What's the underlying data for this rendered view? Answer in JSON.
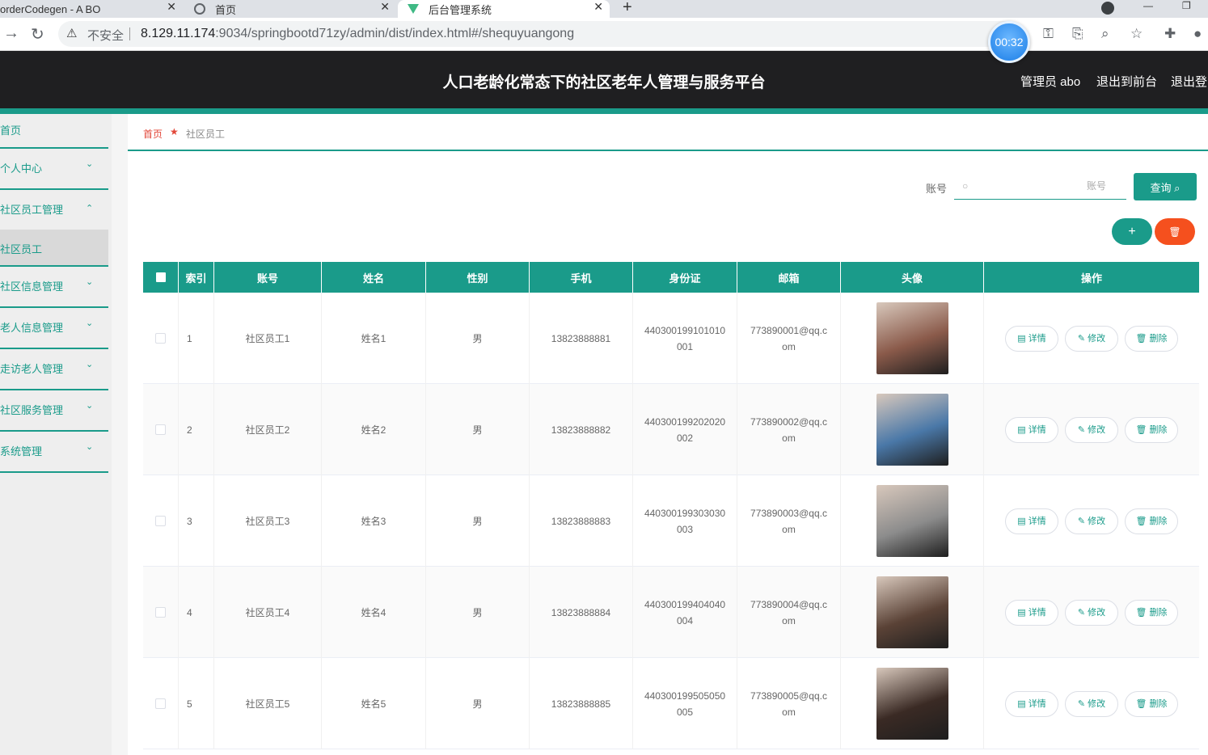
{
  "browser": {
    "tabs": [
      {
        "label": "orderCodegen - A BO"
      },
      {
        "label": "首页"
      },
      {
        "label": "后台管理系统"
      }
    ],
    "insecure_label": "不安全",
    "url_host": "8.129.11.174",
    "url_rest": ":9034/springbootd71zy/admin/dist/index.html#/shequyuangong",
    "timer": "00:32"
  },
  "header": {
    "title": "人口老龄化常态下的社区老年人管理与服务平台",
    "user": "管理员 abo",
    "to_front": "退出到前台",
    "logout": "退出登录"
  },
  "sidebar": {
    "items": [
      {
        "label": "首页",
        "chevron": ""
      },
      {
        "label": "个人中心",
        "chevron": "⌄"
      },
      {
        "label": "社区员工管理",
        "chevron": "⌃"
      },
      {
        "label": "社区员工",
        "chevron": ""
      },
      {
        "label": "社区信息管理",
        "chevron": "⌄"
      },
      {
        "label": "老人信息管理",
        "chevron": "⌄"
      },
      {
        "label": "走访老人管理",
        "chevron": "⌄"
      },
      {
        "label": "社区服务管理",
        "chevron": "⌄"
      },
      {
        "label": "系统管理",
        "chevron": "⌄"
      }
    ]
  },
  "breadcrumb": {
    "home": "首页",
    "current": "社区员工"
  },
  "search": {
    "label": "账号",
    "placeholder": "账号",
    "button": "查询 ⌕"
  },
  "actions": {
    "add": "+",
    "delete": "🗑"
  },
  "table": {
    "headers": [
      "索引",
      "账号",
      "姓名",
      "性别",
      "手机",
      "身份证",
      "邮箱",
      "头像",
      "操作"
    ],
    "buttons": {
      "detail": "▤ 详情",
      "edit": "✎ 修改",
      "delete": "🗑 删除"
    },
    "rows": [
      {
        "index": "1",
        "account": "社区员工1",
        "name": "姓名1",
        "gender": "男",
        "phone": "13823888881",
        "id_card_1": "440300199101010",
        "id_card_2": "001",
        "email_1": "773890001@qq.c",
        "email_2": "om",
        "avatar": "#8a5a4a"
      },
      {
        "index": "2",
        "account": "社区员工2",
        "name": "姓名2",
        "gender": "男",
        "phone": "13823888882",
        "id_card_1": "440300199202020",
        "id_card_2": "002",
        "email_1": "773890002@qq.c",
        "email_2": "om",
        "avatar": "#4a78a8"
      },
      {
        "index": "3",
        "account": "社区员工3",
        "name": "姓名3",
        "gender": "男",
        "phone": "13823888883",
        "id_card_1": "440300199303030",
        "id_card_2": "003",
        "email_1": "773890003@qq.c",
        "email_2": "om",
        "avatar": "#8c8c8c"
      },
      {
        "index": "4",
        "account": "社区员工4",
        "name": "姓名4",
        "gender": "男",
        "phone": "13823888884",
        "id_card_1": "440300199404040",
        "id_card_2": "004",
        "email_1": "773890004@qq.c",
        "email_2": "om",
        "avatar": "#5a4236"
      },
      {
        "index": "5",
        "account": "社区员工5",
        "name": "姓名5",
        "gender": "男",
        "phone": "13823888885",
        "id_card_1": "440300199505050",
        "id_card_2": "005",
        "email_1": "773890005@qq.c",
        "email_2": "om",
        "avatar": "#3a2a24"
      }
    ]
  },
  "colors": {
    "accent": "#1a9b8a",
    "danger": "#f5501e",
    "header_bg": "#1f1f21"
  }
}
